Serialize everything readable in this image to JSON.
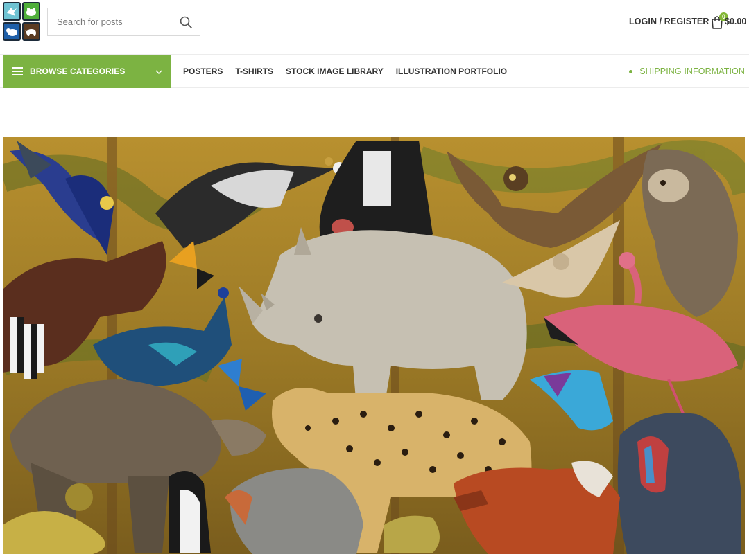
{
  "header": {
    "logo_icons": [
      "bird-icon",
      "frog-icon",
      "hippo-icon",
      "rhino-icon"
    ],
    "search": {
      "placeholder": "Search for posts",
      "value": "",
      "icon": "search-icon"
    },
    "login_label": "LOGIN / REGISTER",
    "cart": {
      "count": "0",
      "total": "$0.00",
      "icon": "shopping-bag-icon"
    }
  },
  "nav": {
    "browse_label": "BROWSE CATEGORIES",
    "browse_icon": "hamburger-icon",
    "browse_chevron": "chevron-down-icon",
    "items": [
      {
        "label": "POSTERS"
      },
      {
        "label": "T-SHIRTS"
      },
      {
        "label": "STOCK IMAGE LIBRARY"
      },
      {
        "label": "ILLUSTRATION PORTFOLIO"
      }
    ],
    "shipping_label": "SHIPPING INFORMATION"
  },
  "hero": {
    "subject": "illustration-collage"
  },
  "colors": {
    "accent": "#7cb342",
    "text": "#333333",
    "border": "#d9d9d9"
  }
}
